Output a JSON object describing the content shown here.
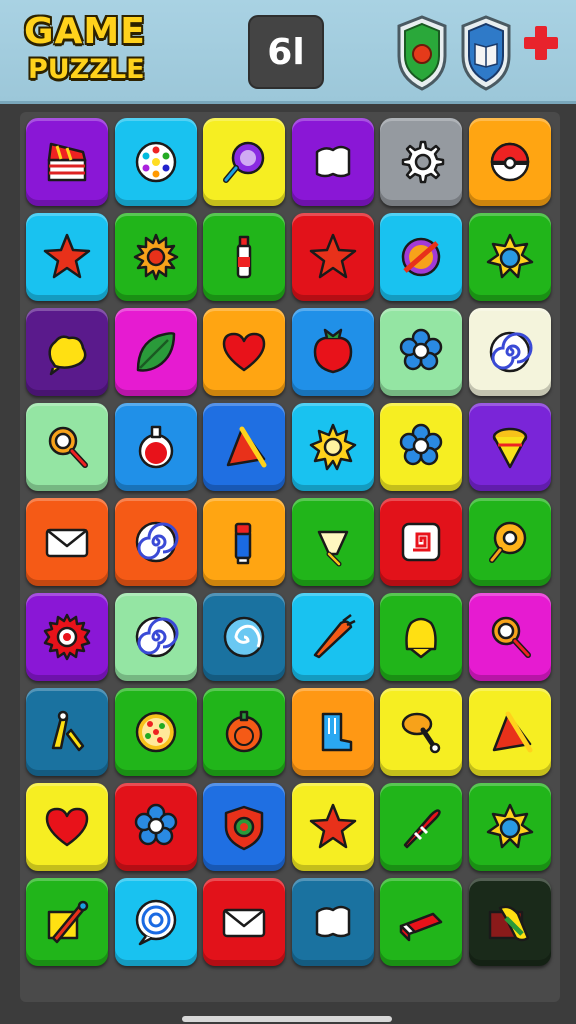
{
  "header": {
    "title_line1": "GAME",
    "title_line2": "PUZZLE",
    "counter": "6l"
  },
  "colors": {
    "purple": "#8a17d6",
    "cyan": "#19c2f0",
    "yellow": "#f6ee22",
    "gray": "#959aa0",
    "orange": "#ffa512",
    "green": "#21b51a",
    "red": "#e2121a",
    "darkpurple": "#5a1a8c",
    "magenta": "#e61bd1",
    "blue": "#2090e8",
    "mint": "#94e5a3",
    "cream": "#f4f4dc",
    "royal": "#1f6fe2",
    "violet": "#7a25d8",
    "orangered": "#f55a16",
    "teal": "#1a72a0",
    "orange2": "#ff9814",
    "dark": "#1a2a1a"
  },
  "grid": [
    [
      {
        "color": "purple",
        "icon": "clapperboard-icon"
      },
      {
        "color": "cyan",
        "icon": "palette-icon"
      },
      {
        "color": "yellow",
        "icon": "potion-icon"
      },
      {
        "color": "purple",
        "icon": "cloud-icon"
      },
      {
        "color": "gray",
        "icon": "gear-icon"
      },
      {
        "color": "orange",
        "icon": "pokeball-icon"
      }
    ],
    [
      {
        "color": "cyan",
        "icon": "star-icon"
      },
      {
        "color": "green",
        "icon": "sun-gear-icon"
      },
      {
        "color": "green",
        "icon": "bottle-icon"
      },
      {
        "color": "red",
        "icon": "star-icon"
      },
      {
        "color": "cyan",
        "icon": "no-sign-icon"
      },
      {
        "color": "green",
        "icon": "star-ball-icon"
      }
    ],
    [
      {
        "color": "darkpurple",
        "icon": "blob-icon"
      },
      {
        "color": "magenta",
        "icon": "leaf-icon"
      },
      {
        "color": "orange",
        "icon": "heart-icon"
      },
      {
        "color": "blue",
        "icon": "fruit-icon"
      },
      {
        "color": "mint",
        "icon": "flower-icon"
      },
      {
        "color": "cream",
        "icon": "spiral-icon"
      }
    ],
    [
      {
        "color": "mint",
        "icon": "magnifier-icon"
      },
      {
        "color": "blue",
        "icon": "flask-icon"
      },
      {
        "color": "royal",
        "icon": "flag-icon"
      },
      {
        "color": "cyan",
        "icon": "sun-icon"
      },
      {
        "color": "yellow",
        "icon": "flower-icon"
      },
      {
        "color": "violet",
        "icon": "spinning-top-icon"
      }
    ],
    [
      {
        "color": "orangered",
        "icon": "envelope-icon"
      },
      {
        "color": "orangered",
        "icon": "spiral-icon"
      },
      {
        "color": "orange",
        "icon": "marker-icon"
      },
      {
        "color": "green",
        "icon": "ice-cream-icon"
      },
      {
        "color": "red",
        "icon": "square-spiral-icon"
      },
      {
        "color": "green",
        "icon": "gear-magnifier-icon"
      }
    ],
    [
      {
        "color": "purple",
        "icon": "sawblade-icon"
      },
      {
        "color": "mint",
        "icon": "spiral-icon"
      },
      {
        "color": "teal",
        "icon": "swirl-ball-icon"
      },
      {
        "color": "cyan",
        "icon": "carrot-icon"
      },
      {
        "color": "green",
        "icon": "bell-icon"
      },
      {
        "color": "magenta",
        "icon": "magnifier-icon"
      }
    ],
    [
      {
        "color": "teal",
        "icon": "pens-icon"
      },
      {
        "color": "green",
        "icon": "pizza-icon"
      },
      {
        "color": "green",
        "icon": "apple-icon"
      },
      {
        "color": "orange2",
        "icon": "boot-icon"
      },
      {
        "color": "yellow",
        "icon": "top-icon"
      },
      {
        "color": "yellow",
        "icon": "flag-icon"
      }
    ],
    [
      {
        "color": "yellow",
        "icon": "heart-icon"
      },
      {
        "color": "red",
        "icon": "flower-icon"
      },
      {
        "color": "royal",
        "icon": "shield-icon"
      },
      {
        "color": "yellow",
        "icon": "star-icon"
      },
      {
        "color": "green",
        "icon": "rocket-icon"
      },
      {
        "color": "green",
        "icon": "star-ball-icon"
      }
    ],
    [
      {
        "color": "green",
        "icon": "brush-icon"
      },
      {
        "color": "cyan",
        "icon": "target-icon"
      },
      {
        "color": "red",
        "icon": "envelope-icon"
      },
      {
        "color": "teal",
        "icon": "cloud-icon"
      },
      {
        "color": "green",
        "icon": "eraser-icon"
      },
      {
        "color": "dark",
        "icon": "popsicle-icon"
      }
    ]
  ]
}
